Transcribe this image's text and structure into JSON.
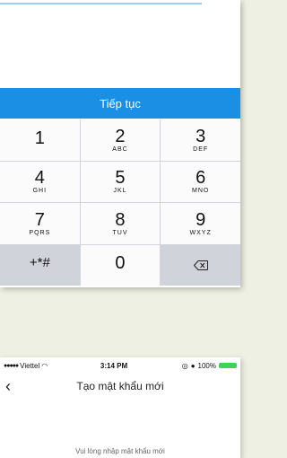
{
  "top_screen": {
    "continue_label": "Tiếp tục",
    "keypad": [
      {
        "num": "1",
        "letters": ""
      },
      {
        "num": "2",
        "letters": "ABC"
      },
      {
        "num": "3",
        "letters": "DEF"
      },
      {
        "num": "4",
        "letters": "GHI"
      },
      {
        "num": "5",
        "letters": "JKL"
      },
      {
        "num": "6",
        "letters": "MNO"
      },
      {
        "num": "7",
        "letters": "PQRS"
      },
      {
        "num": "8",
        "letters": "TUV"
      },
      {
        "num": "9",
        "letters": "WXYZ"
      },
      {
        "num": "+*#",
        "letters": ""
      },
      {
        "num": "0",
        "letters": ""
      }
    ],
    "backspace_icon": "backspace-icon"
  },
  "bottom_screen": {
    "status_bar": {
      "carrier": "Viettel",
      "time": "3:14 PM",
      "battery": "100%",
      "battery_color": "#3bd35a"
    },
    "nav_title": "Tạo mật khẩu mới",
    "back_icon": "chevron-left-icon",
    "instruction": "Vui lòng nhập mật khẩu mới"
  }
}
